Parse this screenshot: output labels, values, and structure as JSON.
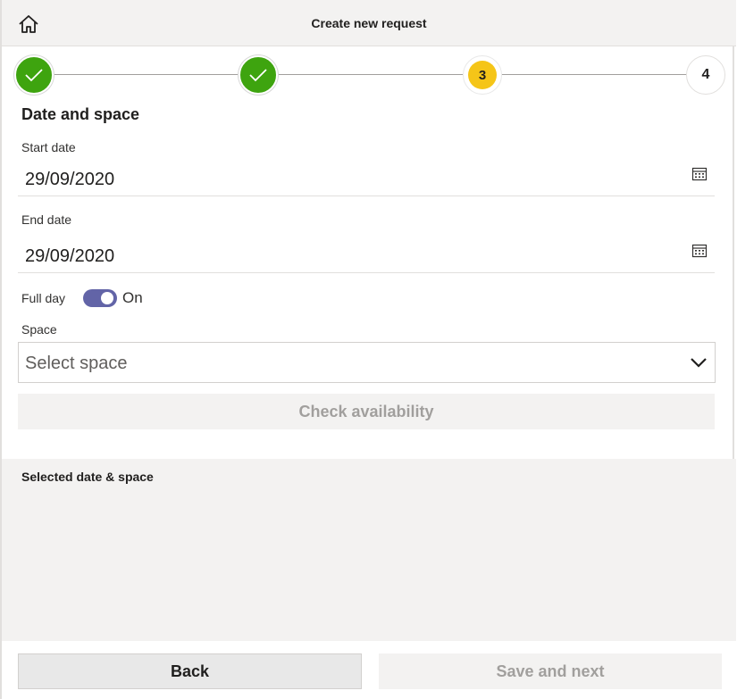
{
  "header": {
    "title": "Create new request",
    "home_icon": "home-icon"
  },
  "stepper": {
    "steps": [
      {
        "label": "",
        "state": "done"
      },
      {
        "label": "",
        "state": "done"
      },
      {
        "label": "3",
        "state": "current"
      },
      {
        "label": "4",
        "state": "todo"
      }
    ],
    "colors": {
      "done": "#3ea40f",
      "current": "#f5c518"
    }
  },
  "form": {
    "section_title": "Date and space",
    "start_date": {
      "label": "Start date",
      "value": "29/09/2020",
      "icon": "calendar-icon"
    },
    "end_date": {
      "label": "End date",
      "value": "29/09/2020",
      "icon": "calendar-icon"
    },
    "full_day": {
      "label": "Full day",
      "state_text": "On",
      "checked": true,
      "color": "#6264a7"
    },
    "space": {
      "label": "Space",
      "placeholder": "Select space",
      "icon": "chevron-down-icon"
    },
    "check_availability_label": "Check availability"
  },
  "selected": {
    "title": "Selected date & space"
  },
  "footer": {
    "back_label": "Back",
    "save_next_label": "Save and next"
  }
}
